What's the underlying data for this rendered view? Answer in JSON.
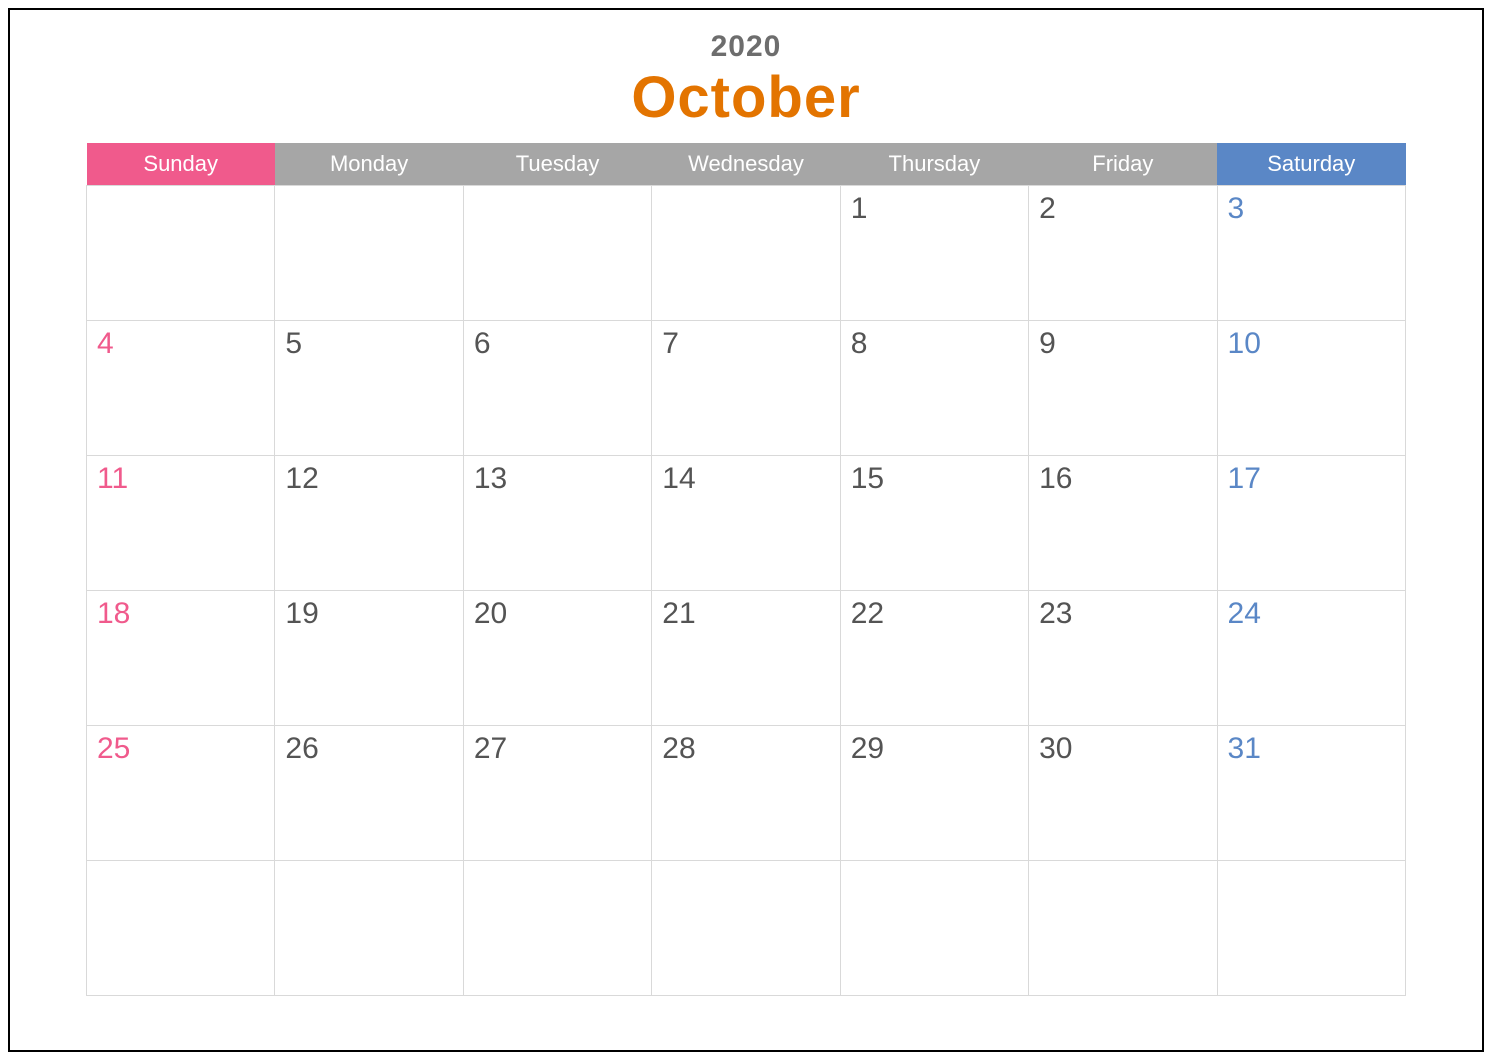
{
  "header": {
    "year": "2020",
    "month": "October"
  },
  "days": {
    "sun": "Sunday",
    "mon": "Monday",
    "tue": "Tuesday",
    "wed": "Wednesday",
    "thu": "Thursday",
    "fri": "Friday",
    "sat": "Saturday"
  },
  "weeks": [
    {
      "sun": "",
      "mon": "",
      "tue": "",
      "wed": "",
      "thu": "1",
      "fri": "2",
      "sat": "3"
    },
    {
      "sun": "4",
      "mon": "5",
      "tue": "6",
      "wed": "7",
      "thu": "8",
      "fri": "9",
      "sat": "10"
    },
    {
      "sun": "11",
      "mon": "12",
      "tue": "13",
      "wed": "14",
      "thu": "15",
      "fri": "16",
      "sat": "17"
    },
    {
      "sun": "18",
      "mon": "19",
      "tue": "20",
      "wed": "21",
      "thu": "22",
      "fri": "23",
      "sat": "24"
    },
    {
      "sun": "25",
      "mon": "26",
      "tue": "27",
      "wed": "28",
      "thu": "29",
      "fri": "30",
      "sat": "31"
    },
    {
      "sun": "",
      "mon": "",
      "tue": "",
      "wed": "",
      "thu": "",
      "fri": "",
      "sat": ""
    }
  ],
  "colors": {
    "sunday_header": "#f05a8c",
    "weekday_header": "#a6a6a6",
    "saturday_header": "#5a87c6",
    "month_title": "#e37400",
    "year_text": "#6d6d6d",
    "weekday_date": "#545454",
    "grid_line": "#d9d9d9"
  }
}
